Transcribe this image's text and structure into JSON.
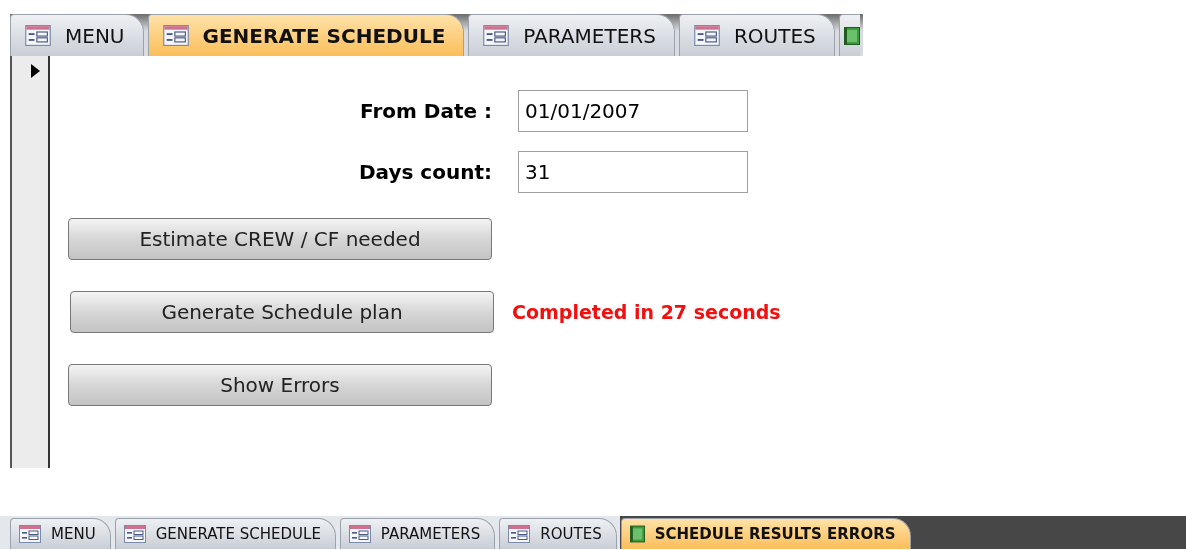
{
  "top_window": {
    "tabs": [
      {
        "label": "MENU",
        "kind": "form",
        "selected": false
      },
      {
        "label": "GENERATE SCHEDULE",
        "kind": "form",
        "selected": true
      },
      {
        "label": "PARAMETERS",
        "kind": "form",
        "selected": false
      },
      {
        "label": "ROUTES",
        "kind": "form",
        "selected": false
      },
      {
        "kind": "report",
        "selected": false
      }
    ],
    "record_selector": {
      "current": true
    },
    "form": {
      "fields": [
        {
          "label": "From Date :",
          "value": "01/01/2007"
        },
        {
          "label": "Days count:",
          "value": "31"
        }
      ],
      "buttons": [
        {
          "label": "Estimate CREW / CF needed"
        },
        {
          "label": "Generate Schedule plan",
          "status": "Completed in 27 seconds"
        },
        {
          "label": "Show Errors"
        }
      ]
    }
  },
  "bottom_tabs": [
    {
      "label": "MENU",
      "kind": "form",
      "selected": false
    },
    {
      "label": "GENERATE SCHEDULE",
      "kind": "form",
      "selected": false
    },
    {
      "label": "PARAMETERS",
      "kind": "form",
      "selected": false
    },
    {
      "label": "ROUTES",
      "kind": "form",
      "selected": false
    },
    {
      "label": "SCHEDULE RESULTS ERRORS",
      "kind": "report",
      "selected": true
    }
  ]
}
